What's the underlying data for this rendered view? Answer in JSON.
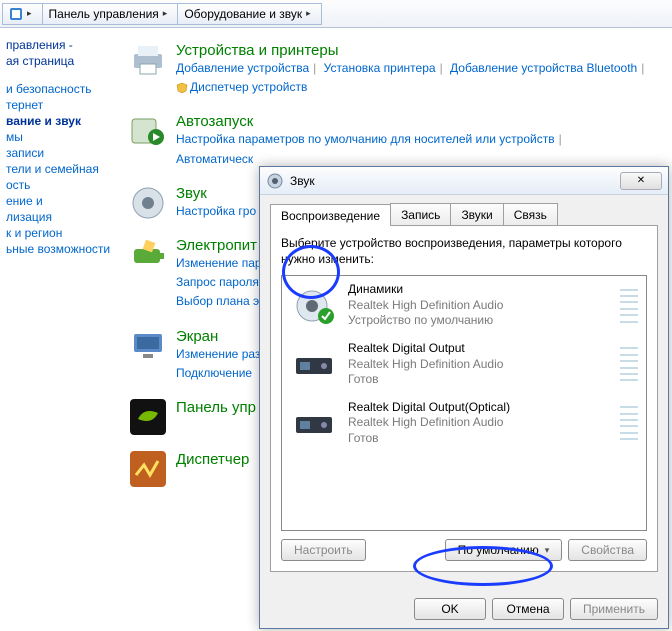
{
  "breadcrumb": {
    "item1": "Панель управления",
    "item2": "Оборудование и звук"
  },
  "sidebar": {
    "head1": "правления -",
    "head2": "ая страница",
    "items": [
      "и безопасность",
      "тернет",
      "вание и звук",
      "мы",
      "записи",
      "тели и семейная",
      "ость",
      "ение и",
      "лизация",
      "к и регион",
      "ьные возможности"
    ]
  },
  "categories": [
    {
      "title": "Устройства и принтеры",
      "links": [
        "Добавление устройства",
        "Установка принтера",
        "Добавление устройства Bluetooth"
      ],
      "extra": "Диспетчер устройств"
    },
    {
      "title": "Автозапуск",
      "links": [
        "Настройка параметров по умолчанию для носителей или устройств"
      ],
      "extra": "Автоматическ"
    },
    {
      "title": "Звук",
      "links": [
        "Настройка гро"
      ]
    },
    {
      "title": "Электропит",
      "links": [
        "Изменение пар",
        "Запрос пароля",
        "Выбор плана э"
      ]
    },
    {
      "title": "Экран",
      "links": [
        "Изменение раз",
        "Подключение"
      ]
    },
    {
      "title": "Панель упр"
    },
    {
      "title": "Диспетчер"
    }
  ],
  "dialog": {
    "title": "Звук",
    "tabs": [
      "Воспроизведение",
      "Запись",
      "Звуки",
      "Связь"
    ],
    "instruction": "Выберите устройство воспроизведения, параметры которого нужно изменить:",
    "devices": [
      {
        "name": "Динамики",
        "sub1": "Realtek High Definition Audio",
        "sub2": "Устройство по умолчанию"
      },
      {
        "name": "Realtek Digital Output",
        "sub1": "Realtek High Definition Audio",
        "sub2": "Готов"
      },
      {
        "name": "Realtek Digital Output(Optical)",
        "sub1": "Realtek High Definition Audio",
        "sub2": "Готов"
      }
    ],
    "buttons": {
      "configure": "Настроить",
      "default": "По умолчанию",
      "properties": "Свойства",
      "ok": "OK",
      "cancel": "Отмена",
      "apply": "Применить"
    }
  }
}
